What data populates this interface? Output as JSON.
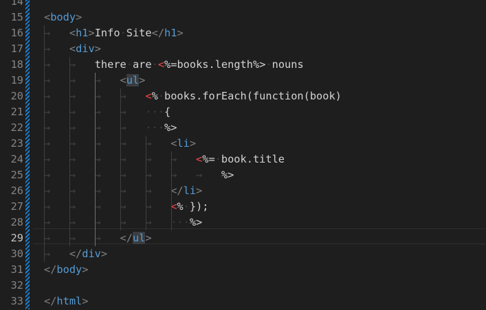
{
  "editor": {
    "active_line": "29",
    "lines": [
      {
        "num": "14",
        "segs": []
      },
      {
        "num": "15",
        "segs": [
          {
            "c": "br",
            "t": "<"
          },
          {
            "c": "tag",
            "t": "body"
          },
          {
            "c": "br",
            "t": ">"
          }
        ]
      },
      {
        "num": "16",
        "segs": [
          {
            "c": "ws",
            "t": "→   "
          },
          {
            "c": "br",
            "t": "<"
          },
          {
            "c": "tag",
            "t": "h1"
          },
          {
            "c": "br",
            "t": ">"
          },
          {
            "c": "txt",
            "t": "Info"
          },
          {
            "c": "ws",
            "t": "·"
          },
          {
            "c": "txt",
            "t": "Site"
          },
          {
            "c": "br",
            "t": "</"
          },
          {
            "c": "tag",
            "t": "h1"
          },
          {
            "c": "br",
            "t": ">"
          }
        ]
      },
      {
        "num": "17",
        "segs": [
          {
            "c": "ws",
            "t": "→   "
          },
          {
            "c": "br",
            "t": "<"
          },
          {
            "c": "tag",
            "t": "div"
          },
          {
            "c": "br",
            "t": ">"
          }
        ]
      },
      {
        "num": "18",
        "segs": [
          {
            "c": "ws",
            "t": "→   →   "
          },
          {
            "c": "txt",
            "t": "there"
          },
          {
            "c": "ws",
            "t": "·"
          },
          {
            "c": "txt",
            "t": "are"
          },
          {
            "c": "ws",
            "t": "·"
          },
          {
            "c": "ejs",
            "t": "<"
          },
          {
            "c": "txt",
            "t": "%=books.length%>"
          },
          {
            "c": "ws",
            "t": "·"
          },
          {
            "c": "txt",
            "t": "nouns"
          }
        ]
      },
      {
        "num": "19",
        "segs": [
          {
            "c": "ws",
            "t": "→   →   →   "
          },
          {
            "c": "br",
            "t": "<"
          },
          {
            "c": "tag hl",
            "t": "ul"
          },
          {
            "c": "br",
            "t": ">"
          }
        ]
      },
      {
        "num": "20",
        "segs": [
          {
            "c": "ws",
            "t": "→   →   →   →   "
          },
          {
            "c": "ejs",
            "t": "<"
          },
          {
            "c": "txt",
            "t": "%"
          },
          {
            "c": "ws",
            "t": "·"
          },
          {
            "c": "txt",
            "t": "books.forEach(function(book)"
          }
        ]
      },
      {
        "num": "21",
        "segs": [
          {
            "c": "ws",
            "t": "→   →   →   →   ···"
          },
          {
            "c": "txt",
            "t": "{"
          }
        ]
      },
      {
        "num": "22",
        "segs": [
          {
            "c": "ws",
            "t": "→   →   →   →   ···"
          },
          {
            "c": "txt",
            "t": "%>"
          }
        ]
      },
      {
        "num": "23",
        "segs": [
          {
            "c": "ws",
            "t": "→   →   →   →   →   "
          },
          {
            "c": "br",
            "t": "<"
          },
          {
            "c": "tag",
            "t": "li"
          },
          {
            "c": "br",
            "t": ">"
          }
        ]
      },
      {
        "num": "24",
        "segs": [
          {
            "c": "ws",
            "t": "→   →   →   →   →   →   "
          },
          {
            "c": "ejs",
            "t": "<"
          },
          {
            "c": "txt",
            "t": "%="
          },
          {
            "c": "ws",
            "t": "·"
          },
          {
            "c": "txt",
            "t": "book.title"
          }
        ]
      },
      {
        "num": "25",
        "segs": [
          {
            "c": "ws",
            "t": "→   →   →   →   →   →   →   "
          },
          {
            "c": "txt",
            "t": "%>"
          }
        ]
      },
      {
        "num": "26",
        "segs": [
          {
            "c": "ws",
            "t": "→   →   →   →   →   "
          },
          {
            "c": "br",
            "t": "</"
          },
          {
            "c": "tag",
            "t": "li"
          },
          {
            "c": "br",
            "t": ">"
          }
        ]
      },
      {
        "num": "27",
        "segs": [
          {
            "c": "ws",
            "t": "→   →   →   →   →   "
          },
          {
            "c": "ejs",
            "t": "<"
          },
          {
            "c": "txt",
            "t": "%"
          },
          {
            "c": "ws",
            "t": "·"
          },
          {
            "c": "txt",
            "t": "});"
          }
        ]
      },
      {
        "num": "28",
        "segs": [
          {
            "c": "ws",
            "t": "→   →   →   →   →   ···"
          },
          {
            "c": "txt",
            "t": "%>"
          }
        ]
      },
      {
        "num": "29",
        "segs": [
          {
            "c": "ws",
            "t": "→   →   →   "
          },
          {
            "c": "br",
            "t": "</"
          },
          {
            "c": "tag hl",
            "t": "ul"
          },
          {
            "c": "br",
            "t": ">"
          }
        ]
      },
      {
        "num": "30",
        "segs": [
          {
            "c": "ws",
            "t": "→   "
          },
          {
            "c": "br",
            "t": "</"
          },
          {
            "c": "tag",
            "t": "div"
          },
          {
            "c": "br",
            "t": ">"
          }
        ]
      },
      {
        "num": "31",
        "segs": [
          {
            "c": "br",
            "t": "</"
          },
          {
            "c": "tag",
            "t": "body"
          },
          {
            "c": "br",
            "t": ">"
          }
        ]
      },
      {
        "num": "32",
        "segs": []
      },
      {
        "num": "33",
        "segs": [
          {
            "c": "br",
            "t": "</"
          },
          {
            "c": "tag",
            "t": "html"
          },
          {
            "c": "br",
            "t": ">"
          }
        ]
      }
    ]
  }
}
